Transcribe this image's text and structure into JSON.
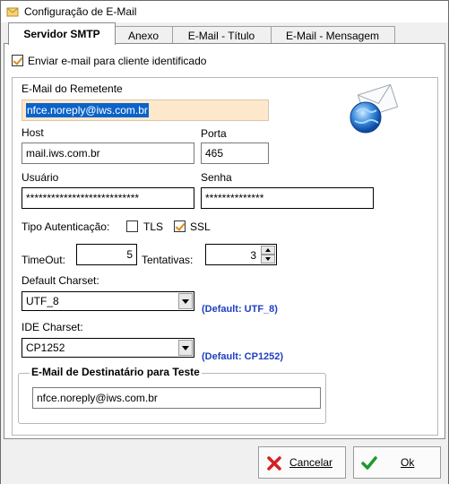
{
  "window": {
    "title": "Configuração de E-Mail"
  },
  "tabs": [
    {
      "label": "Servidor SMTP",
      "active": true
    },
    {
      "label": "Anexo",
      "active": false
    },
    {
      "label": "E-Mail - Título",
      "active": false
    },
    {
      "label": "E-Mail - Mensagem",
      "active": false
    }
  ],
  "options": {
    "send_identified": {
      "label": "Enviar e-mail para cliente identificado",
      "checked": true
    }
  },
  "remetente": {
    "label": "E-Mail do Remetente",
    "value": "nfce.noreply@iws.com.br"
  },
  "host": {
    "label": "Host",
    "value": "mail.iws.com.br"
  },
  "porta": {
    "label": "Porta",
    "value": "465"
  },
  "usuario": {
    "label": "Usuário",
    "value": "***************************"
  },
  "senha": {
    "label": "Senha",
    "value": "**************"
  },
  "auth": {
    "label": "Tipo Autenticação:",
    "tls": {
      "label": "TLS",
      "checked": false
    },
    "ssl": {
      "label": "SSL",
      "checked": true
    }
  },
  "timeout": {
    "label": "TimeOut:",
    "value": "5"
  },
  "tentativas": {
    "label": "Tentativas:",
    "value": "3"
  },
  "default_charset": {
    "label": "Default Charset:",
    "value": "UTF_8",
    "hint": "(Default: UTF_8)"
  },
  "ide_charset": {
    "label": "IDE Charset:",
    "value": "CP1252",
    "hint": "(Default: CP1252)"
  },
  "destinatario": {
    "title": "E-Mail de Destinatário para Teste",
    "value": "nfce.noreply@iws.com.br"
  },
  "buttons": {
    "cancel": "Cancelar",
    "ok": "Ok"
  },
  "icons": {
    "title": "mail-app-icon",
    "envelope": "envelope-globe-icon",
    "cancel": "x-icon",
    "ok": "check-icon"
  },
  "colors": {
    "accent": "#1f3fbf",
    "selection": "#0b63c9",
    "highlight_bg": "#fde8cc",
    "check": "#e0881e"
  }
}
